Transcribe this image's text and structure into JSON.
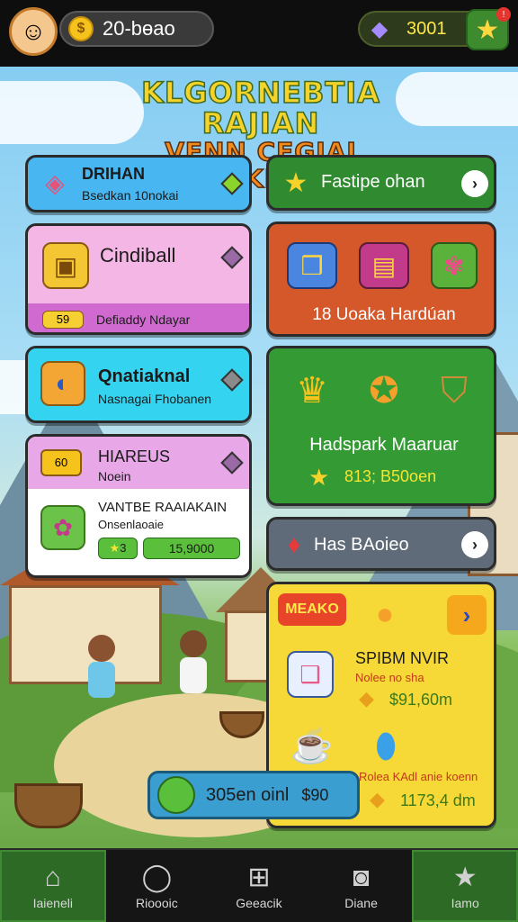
{
  "header": {
    "coins": "20-bɵao",
    "gems": "3001",
    "notification": "!"
  },
  "title": {
    "line1": "KLGORNEBTIA RAJIAN",
    "line2": "VENN CEGIAI MAKIAIS"
  },
  "cards": {
    "dranan": {
      "title": "DRIHAN",
      "subtitle": "Bsedkan 10nokai"
    },
    "feature": {
      "label": "Fastipe ohan",
      "arrow": "›"
    },
    "cindiball": {
      "title": "Cindiball",
      "badge": "59",
      "footer": "Defiaddy Ndayar"
    },
    "uoaka": {
      "label": "18 Uoaka Hardúan"
    },
    "oratial": {
      "title": "Qnatiaknal",
      "subtitle": "Nasnagai Fhobanen"
    },
    "hadspark": {
      "title": "Hadspark Maaruar",
      "value": "813; B50oen"
    },
    "hiarbus": {
      "title": "HIAREUS",
      "badge": "60",
      "subtitle": "Noein",
      "item_title": "VANTBE RAAIAKAIN",
      "item_sub": "Onsenlaoaie",
      "chip1": "3",
      "chip2": "15,9000"
    },
    "hasbaleo": {
      "label": "Has BAoieo",
      "arrow": "›"
    },
    "yellow": {
      "badge": "MEAKO",
      "arrow": "›",
      "item1_title": "SPIBM NVIR",
      "item1_sub": "Nolee no sha",
      "item1_value": "$91,60m",
      "item2_sub": "Rolea KAdl anie koenn",
      "item2_value": "1173,4 dm"
    }
  },
  "bottom_pill": {
    "label": "305en oinl",
    "value": "$90"
  },
  "nav": [
    {
      "label": "Iaieneli",
      "icon": "home-icon",
      "glyph": "⌂"
    },
    {
      "label": "Rioooic",
      "icon": "globe-icon",
      "glyph": "◯"
    },
    {
      "label": "Geeacik",
      "icon": "grid-icon",
      "glyph": "⊞"
    },
    {
      "label": "Diane",
      "icon": "camera-icon",
      "glyph": "◙"
    },
    {
      "label": "Iamo",
      "icon": "star-icon",
      "glyph": "★"
    }
  ]
}
